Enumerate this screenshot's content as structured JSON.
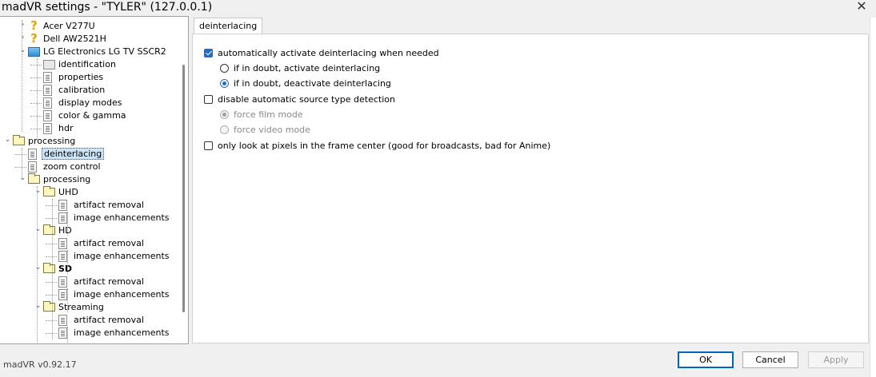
{
  "window": {
    "title": "madVR settings - \"TYLER\" (127.0.0.1)",
    "close_glyph": "✕"
  },
  "tree": [
    {
      "label": "Acer V277U",
      "icon": "question-icon",
      "expand": "›",
      "level": 1
    },
    {
      "label": "Dell AW2521H",
      "icon": "question-icon",
      "expand": "›",
      "level": 1
    },
    {
      "label": "LG Electronics LG TV SSCR2",
      "icon": "monitor-icon",
      "expand": "⌄",
      "level": 1
    },
    {
      "label": "identification",
      "icon": "id-card-icon",
      "level": 2
    },
    {
      "label": "properties",
      "icon": "document-icon",
      "level": 2
    },
    {
      "label": "calibration",
      "icon": "document-icon",
      "level": 2
    },
    {
      "label": "display modes",
      "icon": "document-icon",
      "level": 2
    },
    {
      "label": "color & gamma",
      "icon": "document-icon",
      "level": 2
    },
    {
      "label": "hdr",
      "icon": "document-icon",
      "level": 2
    },
    {
      "label": "processing",
      "icon": "folder-icon",
      "expand": "⌄",
      "level": 0
    },
    {
      "label": "deinterlacing",
      "icon": "document-icon",
      "level": 1,
      "selected": true
    },
    {
      "label": "zoom control",
      "icon": "document-icon",
      "level": 1
    },
    {
      "label": "processing",
      "icon": "folder-icon",
      "expand": "⌄",
      "level": 1
    },
    {
      "label": "UHD",
      "icon": "folder-icon",
      "expand": "⌄",
      "level": 2
    },
    {
      "label": "artifact removal",
      "icon": "document-icon",
      "level": 3
    },
    {
      "label": "image enhancements",
      "icon": "document-icon",
      "level": 3
    },
    {
      "label": "HD",
      "icon": "folder-icon",
      "expand": "⌄",
      "level": 2
    },
    {
      "label": "artifact removal",
      "icon": "document-icon",
      "level": 3
    },
    {
      "label": "image enhancements",
      "icon": "document-icon",
      "level": 3
    },
    {
      "label": "SD",
      "icon": "folder-icon",
      "expand": "⌄",
      "level": 2,
      "bold": true
    },
    {
      "label": "artifact removal",
      "icon": "document-icon",
      "level": 3
    },
    {
      "label": "image enhancements",
      "icon": "document-icon",
      "level": 3
    },
    {
      "label": "Streaming",
      "icon": "folder-icon",
      "expand": "⌄",
      "level": 2
    },
    {
      "label": "artifact removal",
      "icon": "document-icon",
      "level": 3
    },
    {
      "label": "image enhancements",
      "icon": "document-icon",
      "level": 3
    }
  ],
  "tab": {
    "label": "deinterlacing"
  },
  "options": {
    "auto_activate": {
      "label": "automatically activate deinterlacing when needed",
      "checked": true
    },
    "doubt_activate": {
      "label": "if in doubt, activate deinterlacing",
      "selected": false
    },
    "doubt_deactivate": {
      "label": "if in doubt, deactivate deinterlacing",
      "selected": true
    },
    "disable_auto_detect": {
      "label": "disable automatic source type detection",
      "checked": false
    },
    "force_film": {
      "label": "force film mode",
      "selected": true,
      "disabled": true
    },
    "force_video": {
      "label": "force video mode",
      "selected": false,
      "disabled": true
    },
    "frame_center": {
      "label": "only look at pixels in the frame center  (good for broadcasts, bad for Anime)",
      "checked": false
    }
  },
  "footer": {
    "version": "madVR v0.92.17",
    "ok": "OK",
    "cancel": "Cancel",
    "apply": "Apply"
  },
  "colors": {
    "accent": "#1f6fc5",
    "selection": "#cce4f7"
  }
}
